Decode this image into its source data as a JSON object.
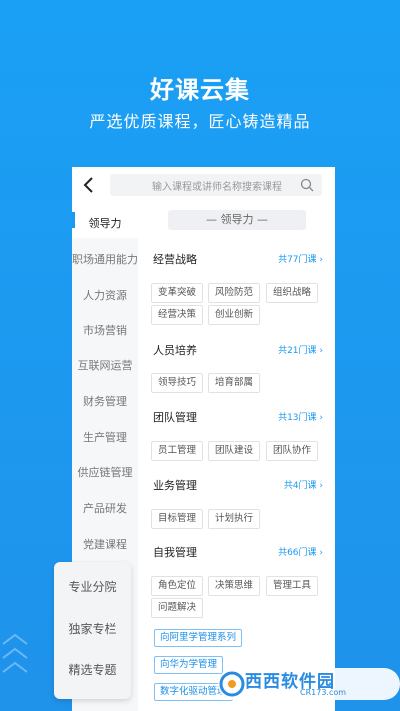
{
  "hero": {
    "title": "好课云集",
    "subtitle": "严选优质课程，匠心铸造精品"
  },
  "search": {
    "placeholder": "输入课程或讲师名称搜索课程"
  },
  "sidebar": {
    "items": [
      {
        "label": "领导力",
        "active": true
      },
      {
        "label": "职场通用能力"
      },
      {
        "label": "人力资源"
      },
      {
        "label": "市场营销"
      },
      {
        "label": "互联网运营"
      },
      {
        "label": "财务管理"
      },
      {
        "label": "生产管理"
      },
      {
        "label": "供应链管理"
      },
      {
        "label": "产品研发"
      },
      {
        "label": "党建课程"
      }
    ]
  },
  "main": {
    "header": "— 领导力 —",
    "categories": [
      {
        "title": "经营战略",
        "more": "共77门课 ›",
        "tags": [
          "变革突破",
          "风险防范",
          "组织战略",
          "经营决策",
          "创业创新"
        ]
      },
      {
        "title": "人员培养",
        "more": "共21门课 ›",
        "tags": [
          "领导技巧",
          "培育部属"
        ]
      },
      {
        "title": "团队管理",
        "more": "共13门课 ›",
        "tags": [
          "员工管理",
          "团队建设",
          "团队协作"
        ]
      },
      {
        "title": "业务管理",
        "more": "共4门课 ›",
        "tags": [
          "目标管理",
          "计划执行"
        ]
      },
      {
        "title": "自我管理",
        "more": "共66门课 ›",
        "tags": [
          "角色定位",
          "决策思维",
          "管理工具",
          "问题解决"
        ]
      }
    ],
    "series_links": [
      "向阿里学管理系列",
      "向华为学管理",
      "数字化驱动管理"
    ]
  },
  "float_panel": {
    "items": [
      "专业分院",
      "独家专栏",
      "精选专题"
    ]
  },
  "watermark": {
    "text": "西西软件园",
    "url": "CR173.com"
  },
  "colors": {
    "brand": "#1a9af0",
    "background": "#1e9af0"
  }
}
